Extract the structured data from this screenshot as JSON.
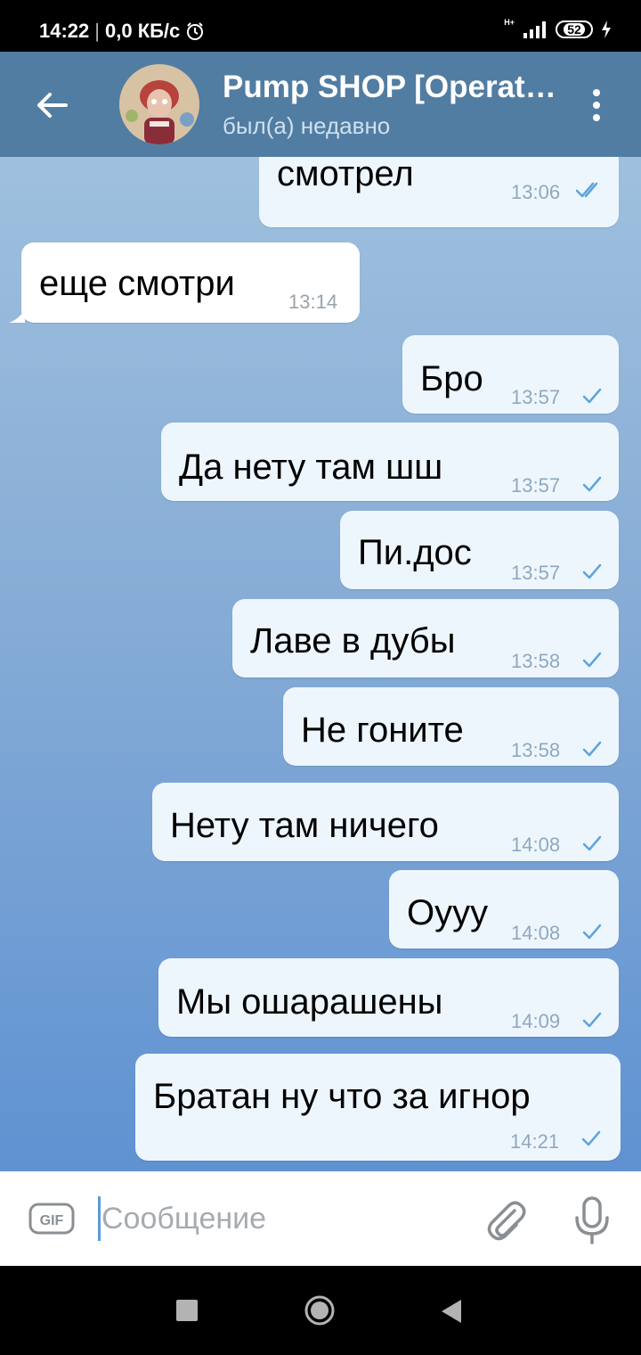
{
  "status_bar": {
    "time": "14:22",
    "speed": "0,0 КБ/с",
    "network": "H+",
    "battery": "52"
  },
  "header": {
    "title": "Pump SHOP [Operat…",
    "status": "был(а) недавно"
  },
  "messages": [
    {
      "text": "смотрел",
      "time": "13:06",
      "direction": "out",
      "status": "read"
    },
    {
      "text": "еще смотри",
      "time": "13:14",
      "direction": "in"
    },
    {
      "text": "Бро",
      "time": "13:57",
      "direction": "out",
      "status": "sent"
    },
    {
      "text": "Да нету там шш",
      "time": "13:57",
      "direction": "out",
      "status": "sent"
    },
    {
      "text": "Пи.дос",
      "time": "13:57",
      "direction": "out",
      "status": "sent"
    },
    {
      "text": "Лаве в дубы",
      "time": "13:58",
      "direction": "out",
      "status": "sent"
    },
    {
      "text": "Не гоните",
      "time": "13:58",
      "direction": "out",
      "status": "sent"
    },
    {
      "text": "Нету там ничего",
      "time": "14:08",
      "direction": "out",
      "status": "sent"
    },
    {
      "text": "Оууу",
      "time": "14:08",
      "direction": "out",
      "status": "sent"
    },
    {
      "text": "Мы ошарашены",
      "time": "14:09",
      "direction": "out",
      "status": "sent"
    },
    {
      "text": "Братан ну что за игнор",
      "time": "14:21",
      "direction": "out",
      "status": "sent"
    }
  ],
  "input": {
    "placeholder": "Сообщение",
    "gif_label": "GIF"
  },
  "colors": {
    "header": "#517da2",
    "bubble_out": "#eef6fd",
    "bubble_in": "#ffffff",
    "tick": "#5ea4dd"
  }
}
